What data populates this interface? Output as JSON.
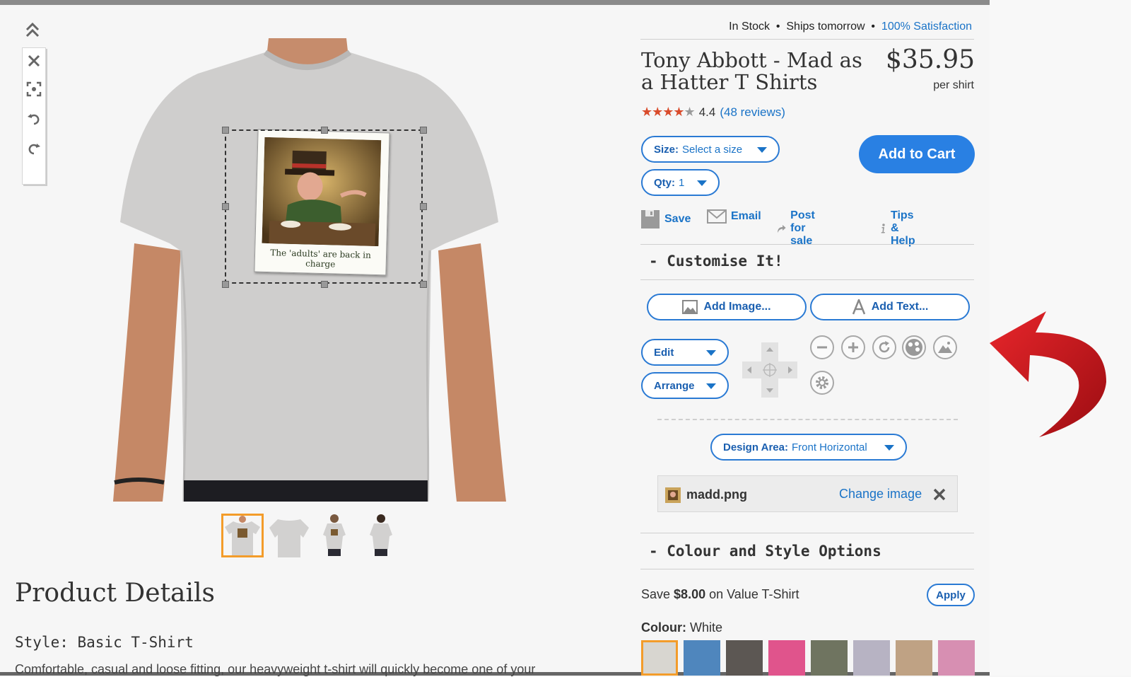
{
  "availability": {
    "in_stock": "In Stock",
    "ships": "Ships tomorrow",
    "satisfaction": "100% Satisfaction",
    "separator": "•"
  },
  "product": {
    "title": "Tony Abbott - Mad as a Hatter T Shirts",
    "price": "$35.95",
    "per": "per shirt",
    "rating_value": 4.4,
    "rating_text": "4.4",
    "reviews": "(48 reviews)"
  },
  "options": {
    "size_label": "Size:",
    "size_value": "Select a size",
    "qty_label": "Qty:",
    "qty_value": "1"
  },
  "add_to_cart": "Add to Cart",
  "actions": {
    "save": "Save",
    "email": "Email",
    "post": "Post for sale",
    "tips": "Tips & Help"
  },
  "customise": {
    "heading": "-  Customise It!",
    "add_image": "Add Image...",
    "add_text": "Add Text...",
    "edit": "Edit",
    "arrange": "Arrange",
    "design_area_label": "Design Area:",
    "design_area_value": "Front Horizontal",
    "file_name": "madd.png",
    "change_image": "Change image"
  },
  "design_caption": "The 'adults' are back in charge",
  "colour_section": {
    "heading": "-  Colour and Style Options",
    "save_prefix": "Save",
    "save_amount": "$8.00",
    "save_suffix": "on Value T-Shirt",
    "apply": "Apply",
    "colour_label": "Colour:",
    "colour_value": "White",
    "swatches": [
      "#d8d6d0",
      "#4f86bd",
      "#5c5753",
      "#e0548c",
      "#6f7460",
      "#b7b3c3",
      "#bfa284",
      "#d78fb2"
    ]
  },
  "product_details": {
    "heading": "Product Details",
    "style": "Style: Basic T-Shirt",
    "description": "Comfortable, casual and loose fitting, our heavyweight t-shirt will quickly become one of your"
  },
  "colors": {
    "accent": "#2980e3",
    "link": "#1a73c7",
    "star": "#d94b2b",
    "selected": "#f39c2a",
    "arrow": "#c8161d"
  }
}
